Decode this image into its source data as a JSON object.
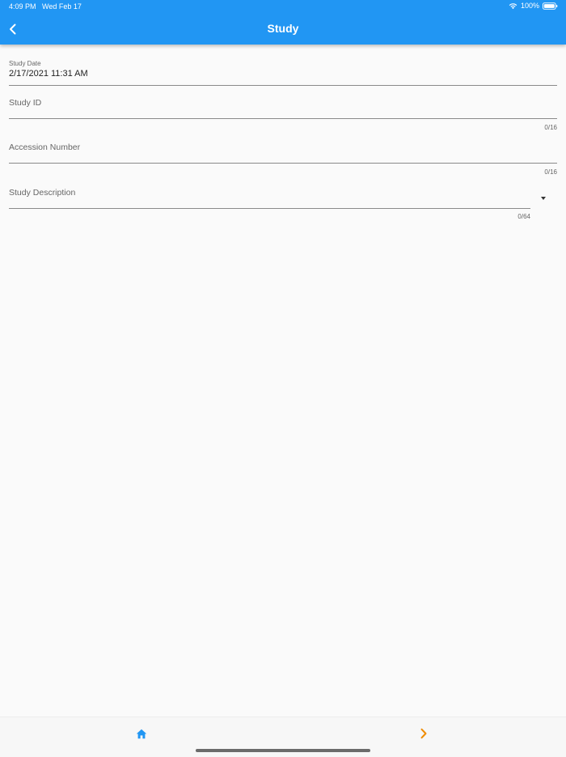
{
  "status_bar": {
    "time": "4:09 PM",
    "date": "Wed Feb 17",
    "battery": "100%"
  },
  "app_bar": {
    "title": "Study",
    "back_icon": "chevron-left-icon"
  },
  "form": {
    "study_date": {
      "label": "Study Date",
      "value": "2/17/2021 11:31 AM"
    },
    "study_id": {
      "label": "Study ID",
      "counter": "0/16"
    },
    "accession_number": {
      "label": "Accession Number",
      "counter": "0/16"
    },
    "study_description": {
      "label": "Study Description",
      "counter": "0/64",
      "dropdown_icon": "arrow-drop-down-icon"
    }
  },
  "bottom_bar": {
    "home_icon": "home-icon",
    "next_icon": "chevron-right-icon"
  },
  "colors": {
    "primary": "#2196f3",
    "background": "#fafafa",
    "next_accent": "#ef8c00",
    "home_icon": "#2196f3"
  }
}
